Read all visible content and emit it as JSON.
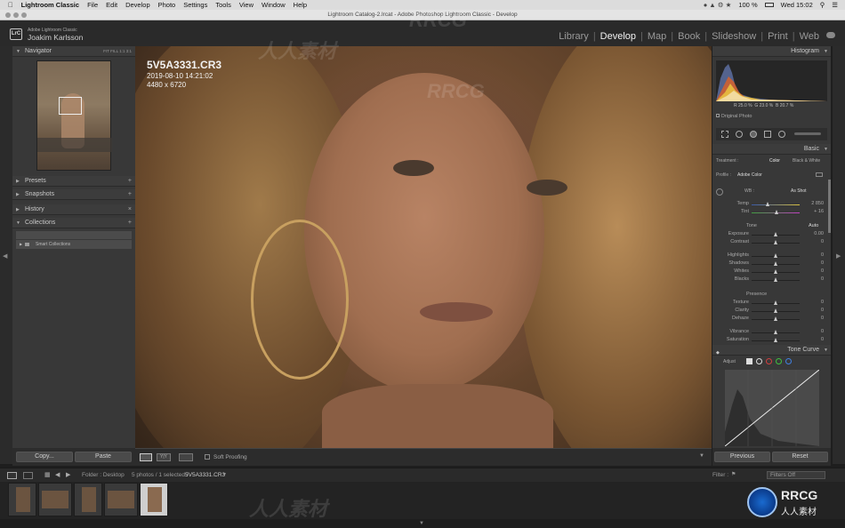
{
  "menubar": {
    "apple_icon": "apple-icon",
    "app_name": "Lightroom Classic",
    "items": [
      "File",
      "Edit",
      "Develop",
      "Photo",
      "Settings",
      "Tools",
      "View",
      "Window",
      "Help"
    ],
    "battery": "100 %",
    "clock": "Wed 15:02"
  },
  "window": {
    "title": "Lightroom Catalog-2.lrcat - Adobe Photoshop Lightroom Classic - Develop"
  },
  "identity": {
    "logo": "LrC",
    "app_label": "Adobe Lightroom Classic",
    "user": "Joakim Karlsson"
  },
  "modules": [
    "Library",
    "Develop",
    "Map",
    "Book",
    "Slideshow",
    "Print",
    "Web"
  ],
  "active_module": "Develop",
  "left_panel": {
    "navigator": {
      "title": "Navigator",
      "zoom_options": [
        "FIT",
        "FILL",
        "1:1",
        "3:1"
      ]
    },
    "sections": [
      {
        "title": "Presets",
        "plus": true
      },
      {
        "title": "Snapshots",
        "plus": true
      },
      {
        "title": "History",
        "plus": false
      },
      {
        "title": "Collections",
        "plus": true
      }
    ],
    "collections_item": "Smart Collections",
    "copy_button": "Copy...",
    "paste_button": "Paste"
  },
  "photo": {
    "filename": "5V5A3331.CR3",
    "datetime": "2019-08-10 14:21:02",
    "dimensions": "4480 x 6720"
  },
  "toolbar": {
    "soft_proofing": "Soft Proofing"
  },
  "right_panel": {
    "histogram": {
      "title": "Histogram",
      "r_value": "25.0",
      "g_value": "23.0",
      "b_value": "20.7",
      "original_photo": "Original Photo"
    },
    "basic": {
      "title": "Basic",
      "treatment_label": "Treatment :",
      "treatment_options": [
        "Color",
        "Black & White"
      ],
      "profile_label": "Profile :",
      "profile_value": "Adobe Color",
      "wb_label": "WB :",
      "wb_value": "As Shot",
      "temp_label": "Temp",
      "temp_value": "2 850",
      "tint_label": "Tint",
      "tint_value": "+ 16",
      "tone_label": "Tone",
      "tone_auto": "Auto",
      "sliders": [
        {
          "label": "Exposure",
          "value": "0.00",
          "pos": 0.5
        },
        {
          "label": "Contrast",
          "value": "0",
          "pos": 0.5
        },
        {
          "label": "Highlights",
          "value": "0",
          "pos": 0.5
        },
        {
          "label": "Shadows",
          "value": "0",
          "pos": 0.5
        },
        {
          "label": "Whites",
          "value": "0",
          "pos": 0.5
        },
        {
          "label": "Blacks",
          "value": "0",
          "pos": 0.5
        }
      ],
      "presence_label": "Presence",
      "presence_sliders": [
        {
          "label": "Texture",
          "value": "0",
          "pos": 0.5
        },
        {
          "label": "Clarity",
          "value": "0",
          "pos": 0.5
        },
        {
          "label": "Dehaze",
          "value": "0",
          "pos": 0.5
        },
        {
          "label": "Vibrance",
          "value": "0",
          "pos": 0.5
        },
        {
          "label": "Saturation",
          "value": "0",
          "pos": 0.5
        }
      ]
    },
    "tone_curve": {
      "title": "Tone Curve",
      "adjust_label": "Adjust"
    },
    "previous_button": "Previous",
    "reset_button": "Reset"
  },
  "filmstrip": {
    "source": "Folder : Desktop",
    "count": "5 photos / 1 selected /",
    "selected": "5V5A3331.CR3",
    "filter_label": "Filter :",
    "filter_value": "Filters Off"
  },
  "watermarks": [
    "RRCG",
    "人人素材",
    "RRCG",
    "人人素材"
  ],
  "badge": {
    "logo": "RRCG",
    "sub": "人人素材"
  }
}
